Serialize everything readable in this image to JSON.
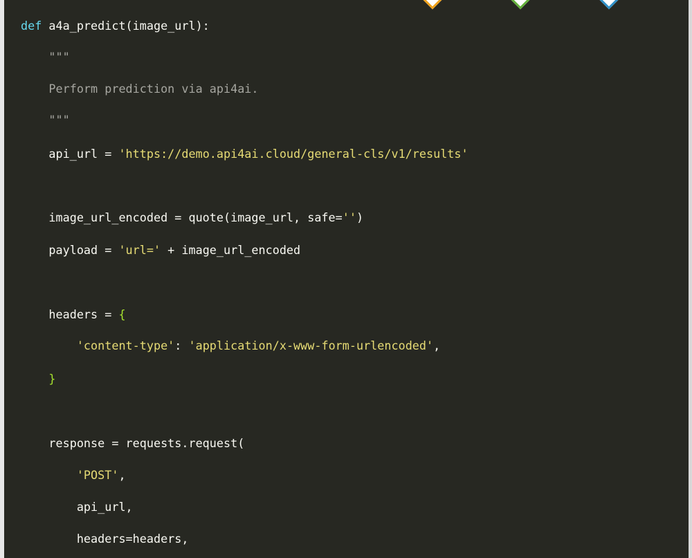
{
  "code": {
    "lines": [
      {
        "id": "l1",
        "tokens": [
          {
            "t": "def",
            "k": "kw"
          },
          {
            "t": " a4a_predict(image_url):",
            "k": "op"
          }
        ]
      },
      {
        "id": "l2",
        "tokens": [
          {
            "t": "    \"\"\"",
            "k": "cmt"
          }
        ]
      },
      {
        "id": "l3",
        "tokens": [
          {
            "t": "    Perform prediction via api4ai.",
            "k": "cmt"
          }
        ]
      },
      {
        "id": "l4",
        "tokens": [
          {
            "t": "    \"\"\"",
            "k": "cmt"
          }
        ]
      },
      {
        "id": "l5",
        "tokens": [
          {
            "t": "    api_url = ",
            "k": "op"
          },
          {
            "t": "'https://demo.api4ai.cloud/general-cls/v1/results'",
            "k": "str"
          }
        ]
      },
      {
        "id": "l6",
        "tokens": [
          {
            "t": "    image_url_encoded = quote(image_url, safe=",
            "k": "op"
          },
          {
            "t": "''",
            "k": "str"
          },
          {
            "t": ")",
            "k": "op"
          }
        ]
      },
      {
        "id": "l7",
        "tokens": [
          {
            "t": "    payload = ",
            "k": "op"
          },
          {
            "t": "'url='",
            "k": "str"
          },
          {
            "t": " + image_url_encoded",
            "k": "op"
          }
        ]
      },
      {
        "id": "l8",
        "tokens": [
          {
            "t": "    headers = ",
            "k": "op"
          },
          {
            "t": "{",
            "k": "brace"
          }
        ]
      },
      {
        "id": "l9",
        "tokens": [
          {
            "t": "        ",
            "k": "op"
          },
          {
            "t": "'content-type'",
            "k": "str"
          },
          {
            "t": ": ",
            "k": "op"
          },
          {
            "t": "'application/x-www-form-urlencoded'",
            "k": "str"
          },
          {
            "t": ",",
            "k": "op"
          }
        ]
      },
      {
        "id": "l10",
        "tokens": [
          {
            "t": "    ",
            "k": "op"
          },
          {
            "t": "}",
            "k": "brace"
          }
        ]
      },
      {
        "id": "l11",
        "tokens": [
          {
            "t": "    response = requests.request(",
            "k": "op"
          }
        ]
      },
      {
        "id": "l12",
        "tokens": [
          {
            "t": "        ",
            "k": "op"
          },
          {
            "t": "'POST'",
            "k": "str"
          },
          {
            "t": ",",
            "k": "op"
          }
        ]
      },
      {
        "id": "l13",
        "tokens": [
          {
            "t": "        api_url,",
            "k": "op"
          }
        ]
      },
      {
        "id": "l14",
        "tokens": [
          {
            "t": "        headers=headers,",
            "k": "op"
          }
        ]
      }
    ]
  },
  "colors": {
    "background": "#272822",
    "keyword": "#66d9ef",
    "string": "#e6db74",
    "comment": "#a6a6a0",
    "default": "#f8f8f2",
    "brace": "#a6e22e"
  },
  "decorations": [
    {
      "name": "orange-diamond-icon",
      "color": "#f0a21b"
    },
    {
      "name": "green-diamond-icon",
      "color": "#64b13c"
    },
    {
      "name": "blue-diamond-icon",
      "color": "#2f8fc6"
    }
  ]
}
